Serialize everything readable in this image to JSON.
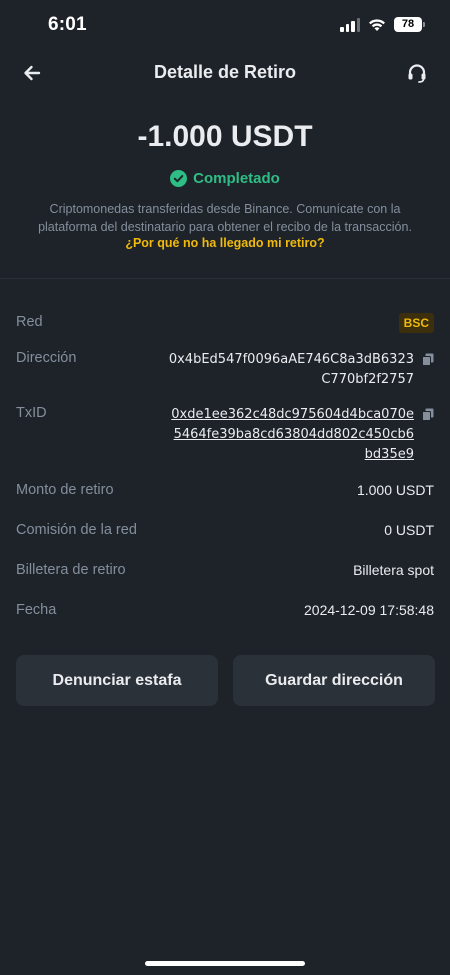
{
  "status_bar": {
    "time": "6:01",
    "battery": "78"
  },
  "nav": {
    "title": "Detalle de Retiro"
  },
  "summary": {
    "amount": "-1.000 USDT",
    "status": "Completado",
    "description": "Criptomonedas transferidas desde Binance. Comunícate con la plataforma del destinatario para obtener el recibo de la transacción.",
    "why_link": "¿Por qué no ha llegado mi retiro?"
  },
  "details": {
    "network_label": "Red",
    "network_value": "BSC",
    "address_label": "Dirección",
    "address_line1": "0x4bEd547f0096aAE746C8a3dB6323",
    "address_line2": "C770bf2f2757",
    "txid_label": "TxID",
    "txid_line1": "0xde1ee362c48dc975604d4bca070e",
    "txid_line2": "5464fe39ba8cd63804dd802c450cb6",
    "txid_line3": "bd35e9",
    "amount_label": "Monto de retiro",
    "amount_value": "1.000 USDT",
    "fee_label": "Comisión de la red",
    "fee_value": "0 USDT",
    "wallet_label": "Billetera de retiro",
    "wallet_value": "Billetera spot",
    "date_label": "Fecha",
    "date_value": "2024-12-09 17:58:48"
  },
  "actions": {
    "report_label": "Denunciar estafa",
    "save_label": "Guardar dirección"
  },
  "colors": {
    "background": "#1e2329",
    "accent": "#f0b90b",
    "success": "#2ebd85",
    "muted": "#848e9c"
  }
}
